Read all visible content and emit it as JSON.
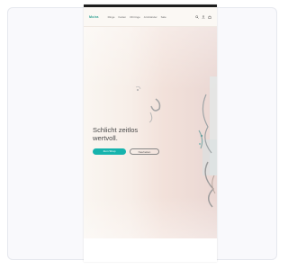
{
  "nav": {
    "logo": "Moira",
    "links": [
      "Ringe",
      "Ketten",
      "Ohrringe",
      "Armbänder",
      "Sale"
    ]
  },
  "hero": {
    "title": "Schlicht zeitlos wertvoll.",
    "primary_button": "Zum Shop",
    "secondary_button": "Neuheiten"
  },
  "colors": {
    "accent": "#16b3ad",
    "statusbar": "#1d1d1d",
    "hero_start": "#faf6f1",
    "hero_end": "#ead7d3"
  },
  "icons": [
    "search-icon",
    "user-icon",
    "bag-icon"
  ]
}
